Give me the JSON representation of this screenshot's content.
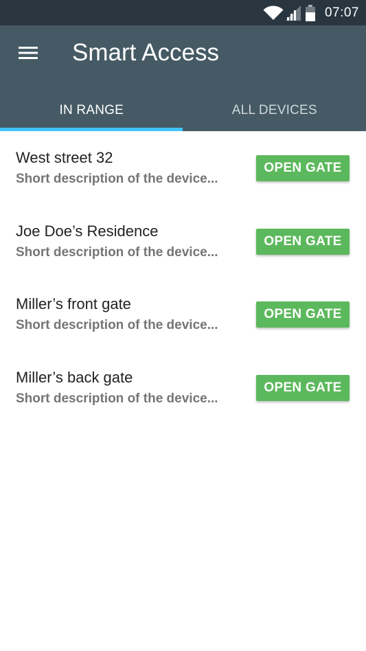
{
  "status_bar": {
    "time": "07:07",
    "icons": [
      "wifi-icon",
      "signal-icon",
      "battery-icon"
    ]
  },
  "app_bar": {
    "menu_icon": "hamburger-menu-icon",
    "title": "Smart Access"
  },
  "tabs": [
    {
      "label": "IN RANGE",
      "active": true
    },
    {
      "label": "ALL DEVICES",
      "active": false
    }
  ],
  "colors": {
    "status_bar": "#293640",
    "app_bar": "#455a64",
    "tab_indicator": "#40c4ff",
    "button": "#5cb85c"
  },
  "devices": [
    {
      "name": "West street 32",
      "description": "Short description of the device...",
      "action": "OPEN GATE"
    },
    {
      "name": "Joe Doe’s Residence",
      "description": "Short description of the device...",
      "action": "OPEN GATE"
    },
    {
      "name": "Miller’s front gate",
      "description": "Short description of the device...",
      "action": "OPEN GATE"
    },
    {
      "name": "Miller’s back gate",
      "description": "Short description of the device...",
      "action": "OPEN GATE"
    }
  ]
}
